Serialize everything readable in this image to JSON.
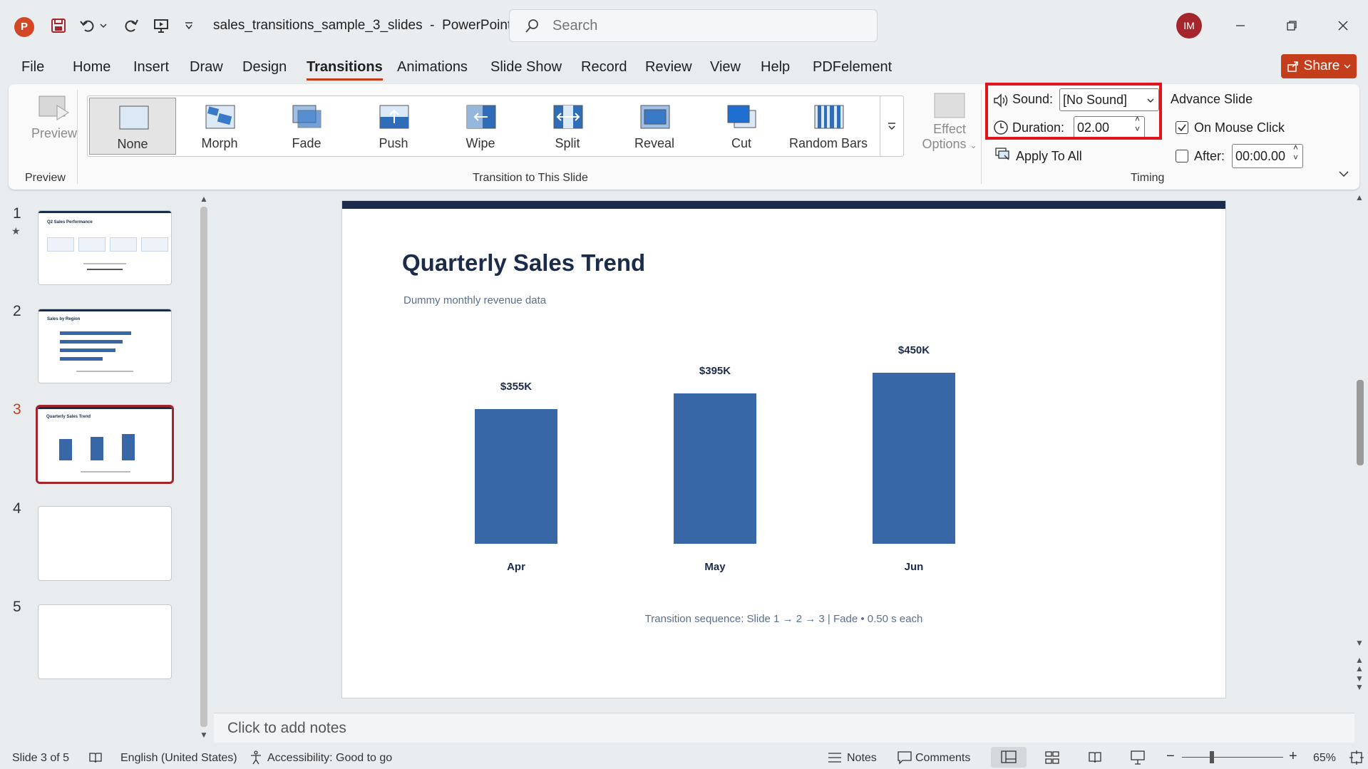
{
  "window": {
    "doc_title": "sales_transitions_sample_3_slides",
    "app_name": "PowerPoint",
    "title_sep": "-",
    "user_initials": "IM"
  },
  "search": {
    "placeholder": "Search"
  },
  "tabs": [
    "File",
    "Home",
    "Insert",
    "Draw",
    "Design",
    "Transitions",
    "Animations",
    "Slide Show",
    "Record",
    "Review",
    "View",
    "Help",
    "PDFelement"
  ],
  "active_tab": "Transitions",
  "share_label": "Share",
  "ribbon": {
    "preview_label": "Preview",
    "preview_group": "Preview",
    "transitions": [
      "None",
      "Morph",
      "Fade",
      "Push",
      "Wipe",
      "Split",
      "Reveal",
      "Cut",
      "Random Bars"
    ],
    "selected_transition": "None",
    "transition_group": "Transition to This Slide",
    "effect_options": {
      "line1": "Effect",
      "line2": "Options"
    },
    "sound_label": "Sound:",
    "sound_value": "[No Sound]",
    "duration_label": "Duration:",
    "duration_value": "02.00",
    "apply_all": "Apply To All",
    "advance_title": "Advance Slide",
    "on_mouse_click": "On Mouse Click",
    "on_mouse_click_checked": true,
    "after_label": "After:",
    "after_checked": false,
    "after_value": "00:00.00",
    "timing_group": "Timing"
  },
  "thumbnails": [
    {
      "num": "1",
      "title": "Q2 Sales Performance",
      "has_star": true
    },
    {
      "num": "2",
      "title": "Sales by Region"
    },
    {
      "num": "3",
      "title": "Quarterly Sales Trend",
      "selected": true
    },
    {
      "num": "4",
      "title": ""
    },
    {
      "num": "5",
      "title": ""
    }
  ],
  "slide": {
    "title": "Quarterly Sales Trend",
    "subtitle": "Dummy monthly revenue data",
    "footnote": "Transition sequence: Slide 1 → 2 → 3  |  Fade • 0.50 s each"
  },
  "chart_data": {
    "type": "bar",
    "categories": [
      "Apr",
      "May",
      "Jun"
    ],
    "values": [
      355,
      395,
      450
    ],
    "data_labels": [
      "$355K",
      "$395K",
      "$450K"
    ],
    "ylim": [
      0,
      500
    ],
    "color": "#3867a8"
  },
  "notes_placeholder": "Click to add notes",
  "status": {
    "slide_pos": "Slide 3 of 5",
    "language": "English (United States)",
    "accessibility": "Accessibility: Good to go",
    "notes": "Notes",
    "comments": "Comments",
    "zoom": "65%"
  },
  "colors": {
    "accent": "#c43e1c",
    "highlight": "#e2141b",
    "slide_title": "#1b2b4a",
    "bar": "#3867a8"
  }
}
